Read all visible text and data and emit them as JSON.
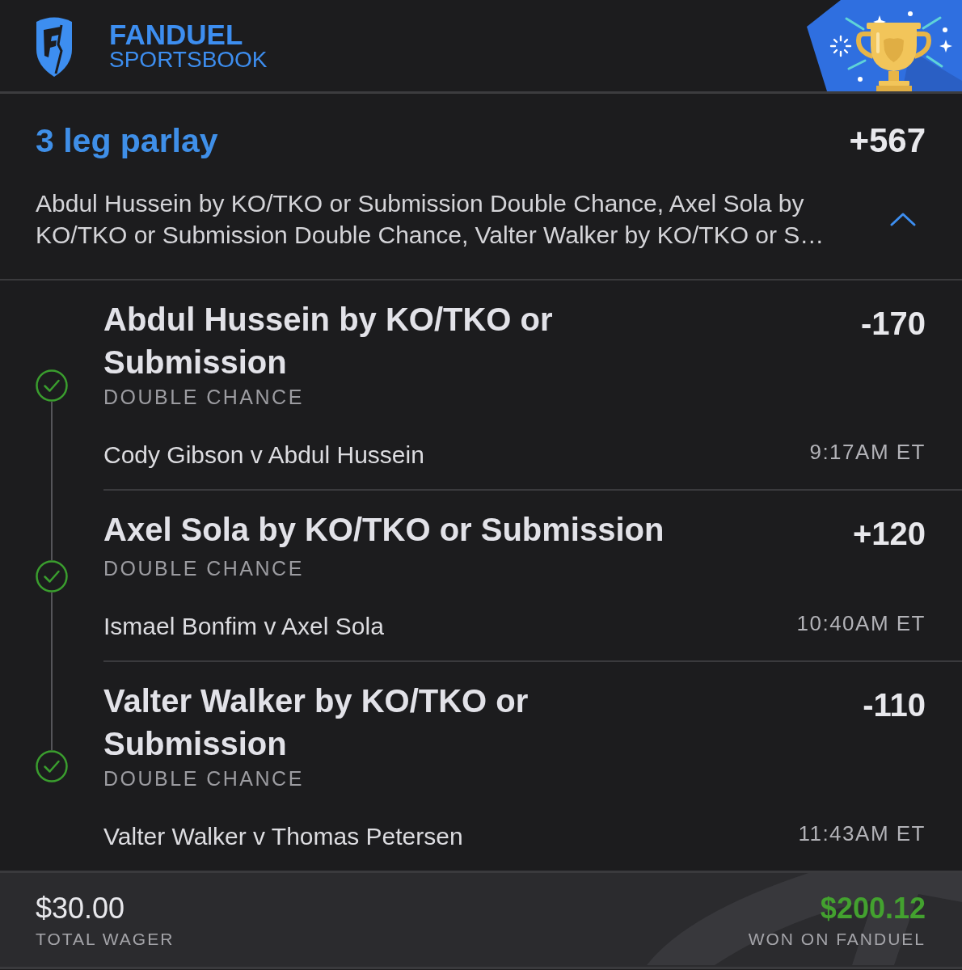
{
  "header": {
    "brand_name": "FANDUEL",
    "brand_subtitle": "SPORTSBOOK"
  },
  "parlay": {
    "title": "3 leg parlay",
    "odds": "+567",
    "description": "Abdul Hussein by KO/TKO or Submission Double Chance, Axel Sola by KO/TKO or Submission Double Chance, Valter Walker by KO/TKO or S…",
    "expanded": true
  },
  "legs": [
    {
      "selection": "Abdul Hussein by KO/TKO or Submission",
      "odds": "-170",
      "market": "DOUBLE CHANCE",
      "matchup": "Cody Gibson v Abdul Hussein",
      "time": "9:17AM ET",
      "won": true
    },
    {
      "selection": "Axel Sola by KO/TKO or Submission",
      "odds": "+120",
      "market": "DOUBLE CHANCE",
      "matchup": "Ismael Bonfim v Axel Sola",
      "time": "10:40AM ET",
      "won": true
    },
    {
      "selection": "Valter Walker by KO/TKO or Submission",
      "odds": "-110",
      "market": "DOUBLE CHANCE",
      "matchup": "Valter Walker v Thomas Petersen",
      "time": "11:43AM ET",
      "won": true
    }
  ],
  "footer": {
    "wager": {
      "amount": "$30.00",
      "label": "TOTAL WAGER"
    },
    "payout": {
      "amount": "$200.12",
      "label": "WON ON FANDUEL",
      "won": true
    }
  }
}
